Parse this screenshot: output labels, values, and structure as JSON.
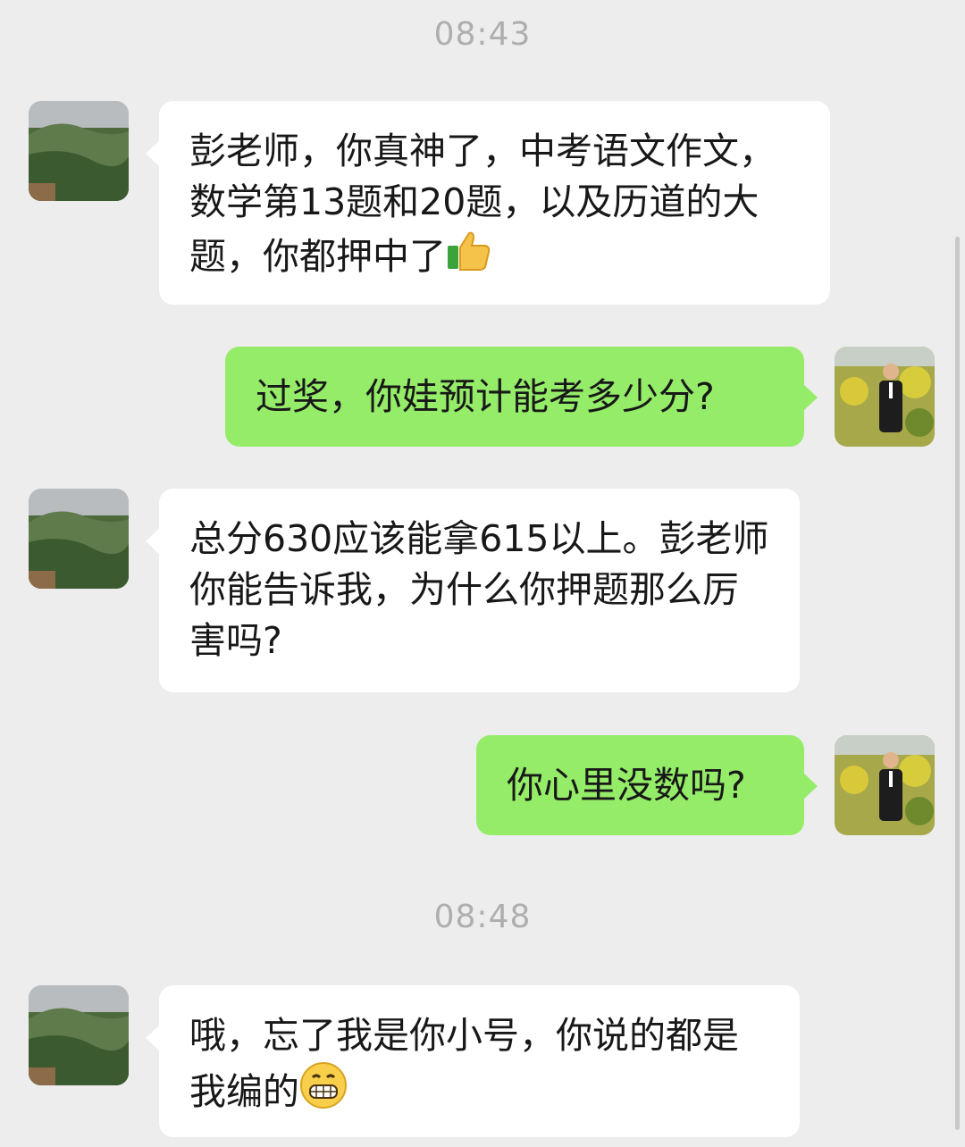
{
  "chat": {
    "timestamps": [
      "08:43",
      "08:48"
    ],
    "messages": [
      {
        "side": "in",
        "avatar": "landscape-avatar",
        "text": "彭老师，你真神了，中考语文作文，数学第13题和20题，以及历道的大题，你都押中了",
        "emoji": "thumbs-up-icon"
      },
      {
        "side": "out",
        "avatar": "man-in-field-avatar",
        "text": "过奖，你娃预计能考多少分?"
      },
      {
        "side": "in",
        "avatar": "landscape-avatar",
        "text": "总分630应该能拿615以上。彭老师你能告诉我，为什么你押题那么厉害吗?"
      },
      {
        "side": "out",
        "avatar": "man-in-field-avatar",
        "text": "你心里没数吗?"
      },
      {
        "side": "in",
        "avatar": "landscape-avatar",
        "text": "哦，忘了我是你小号，你说的都是我编的",
        "emoji": "grinning-face-icon"
      }
    ]
  },
  "colors": {
    "background": "#ededed",
    "incoming_bubble": "#ffffff",
    "outgoing_bubble": "#95ec69",
    "timestamp": "#aeaeae"
  }
}
